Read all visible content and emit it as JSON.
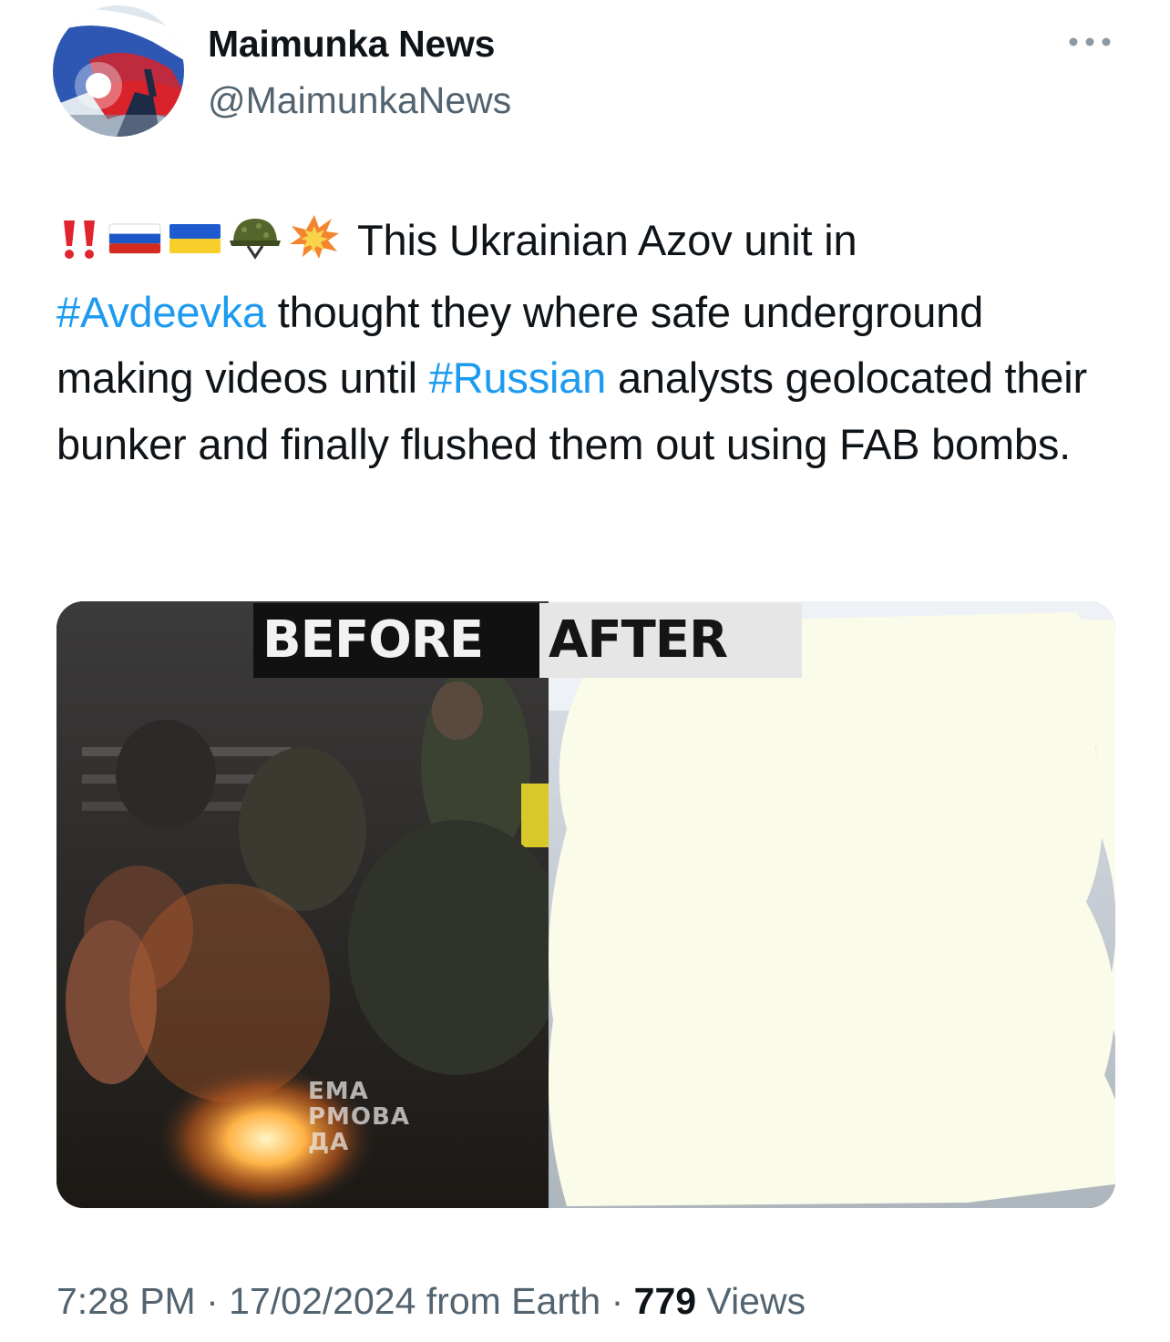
{
  "author": {
    "display_name": "Maimunka News",
    "handle": "@MaimunkaNews"
  },
  "header": {
    "more_icon": "more-horizontal-icon"
  },
  "tweet": {
    "emojis": [
      "double-exclamation-emoji",
      "russia-flag-emoji",
      "ukraine-flag-emoji",
      "military-helmet-emoji",
      "collision-emoji"
    ],
    "text_part_1": "This Ukrainian Azov unit in",
    "hashtag_1": "#Avdeevka",
    "text_part_2": "thought they where safe underground making videos until",
    "hashtag_2": "#Russian",
    "text_part_3": "analysts geolocated their bunker and finally flushed them out using FAB bombs."
  },
  "media": {
    "label_before": "BEFORE",
    "label_after": "AFTER",
    "watermark_lines": [
      "ЕМА",
      "РМОВА",
      "ДА"
    ]
  },
  "footer": {
    "time": "7:28 PM",
    "separator": "·",
    "date": "17/02/2024",
    "source": "from Earth",
    "views_count": "779",
    "views_label": "Views"
  },
  "colors": {
    "link": "#1d9bf0",
    "secondary_text": "#536471",
    "primary_text": "#0f1419",
    "redacted_overlay": "#fbfbea"
  }
}
